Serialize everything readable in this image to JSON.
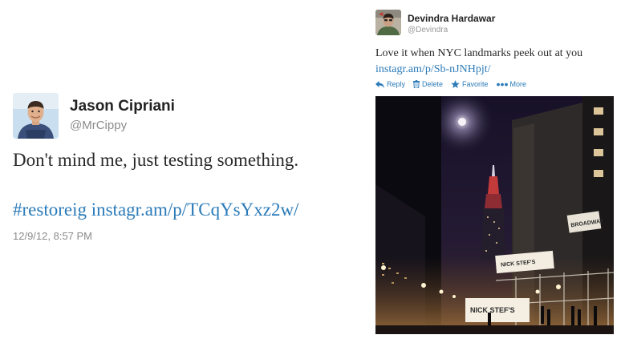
{
  "tweet_left": {
    "name": "Jason Cipriani",
    "handle": "@MrCippy",
    "text": "Don't mind me, just testing something.",
    "hashtag": "#restoreig",
    "link": "instagr.am/p/TCqYsYxz2w/",
    "timestamp": "12/9/12, 8:57 PM",
    "avatar_icon": "person-avatar"
  },
  "tweet_right": {
    "name": "Devindra Hardawar",
    "handle": "@Devindra",
    "text": "Love it when NYC landmarks peek out at you",
    "link": "instagr.am/p/Sb-nJNHpjt/",
    "actions": {
      "reply": "Reply",
      "delete": "Delete",
      "favorite": "Favorite",
      "more": "More"
    },
    "photo_signs": {
      "broadway": "BROADWAY",
      "store_top": "NICK STEF'S",
      "store_bottom": "NICK STEF'S"
    },
    "avatar_icon": "person-avatar"
  },
  "colors": {
    "link": "#2b7bb9",
    "muted": "#8b8b8b",
    "text": "#292929"
  }
}
